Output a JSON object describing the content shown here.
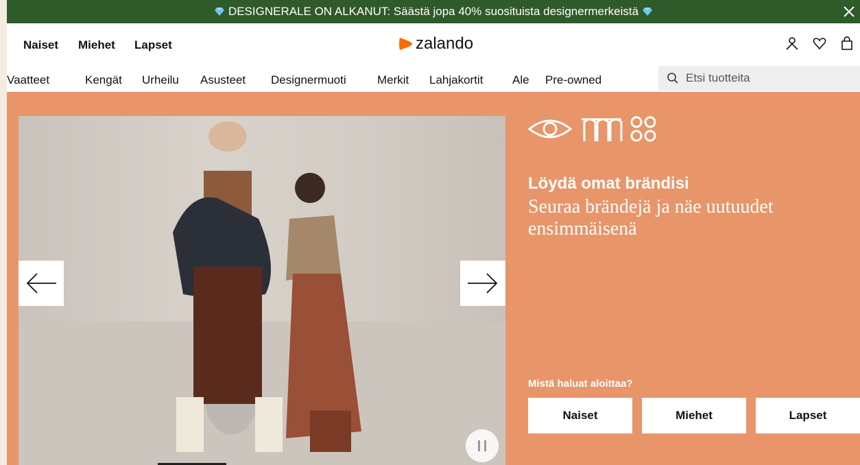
{
  "promo": {
    "text": "DESIGNERALE ON ALKANUT: Säästä jopa 40% suosituista designermerkeistä"
  },
  "header": {
    "gender_links": [
      "Naiset",
      "Miehet",
      "Lapset"
    ],
    "logo_text": "zalando",
    "icons": [
      "user-icon",
      "heart-icon",
      "bag-icon"
    ],
    "brand_color": "#ff6900"
  },
  "nav": {
    "categories": [
      "Vaatteet",
      "Kengät",
      "Urheilu",
      "Asusteet",
      "Designermuoti",
      "Merkit",
      "Lahjakortit",
      "Ale",
      "Pre-owned"
    ],
    "search_placeholder": "Etsi tuotteita"
  },
  "hero": {
    "title": "Löydä omat brändisi",
    "subtitle": "Seuraa brändejä ja näe uutuudet ensimmäisenä",
    "question": "Mistä haluat aloittaa?",
    "buttons": [
      "Naiset",
      "Miehet",
      "Lapset"
    ],
    "background_color": "#e8956a",
    "carousel_icons": [
      "arrow-left-icon",
      "arrow-right-icon",
      "pause-icon"
    ]
  }
}
